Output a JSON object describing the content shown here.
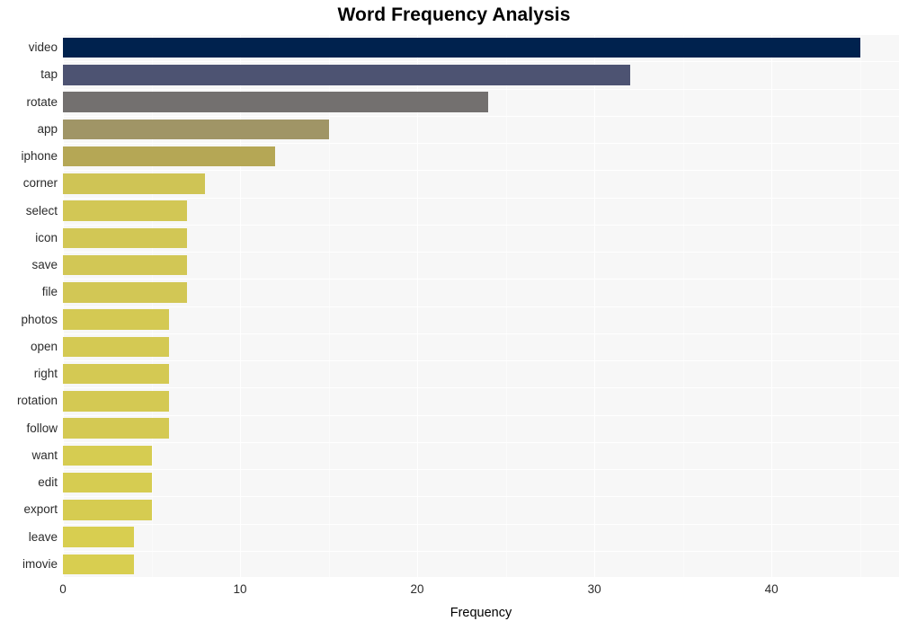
{
  "chart_data": {
    "type": "bar",
    "orientation": "horizontal",
    "title": "Word Frequency Analysis",
    "xlabel": "Frequency",
    "ylabel": "",
    "xlim": [
      0,
      47.2
    ],
    "xticks": [
      0,
      10,
      20,
      30,
      40
    ],
    "xtick_labels": [
      "0",
      "10",
      "20",
      "30",
      "40"
    ],
    "grid": true,
    "legend": "none",
    "categories": [
      "video",
      "tap",
      "rotate",
      "app",
      "iphone",
      "corner",
      "select",
      "icon",
      "save",
      "file",
      "photos",
      "open",
      "right",
      "rotation",
      "follow",
      "want",
      "edit",
      "export",
      "leave",
      "imovie"
    ],
    "values": [
      45,
      32,
      24,
      15,
      12,
      8,
      7,
      7,
      7,
      7,
      6,
      6,
      6,
      6,
      6,
      5,
      5,
      5,
      4,
      4
    ],
    "bar_colors": [
      "#00224e",
      "#4d5372",
      "#73706f",
      "#a09566",
      "#b5a755",
      "#cfc455",
      "#d2c755",
      "#d2c755",
      "#d2c755",
      "#d2c755",
      "#d4c953",
      "#d4c953",
      "#d4c953",
      "#d4c953",
      "#d4c953",
      "#d6cc51",
      "#d6cc51",
      "#d6cc51",
      "#d8ce50",
      "#d8ce50"
    ]
  },
  "style": {
    "panel_background": "#f7f7f7",
    "figure_background": "#ffffff",
    "gridline_color": "#ffffff",
    "tick_label_color": "#2b2b2b",
    "title_color": "#000000"
  }
}
